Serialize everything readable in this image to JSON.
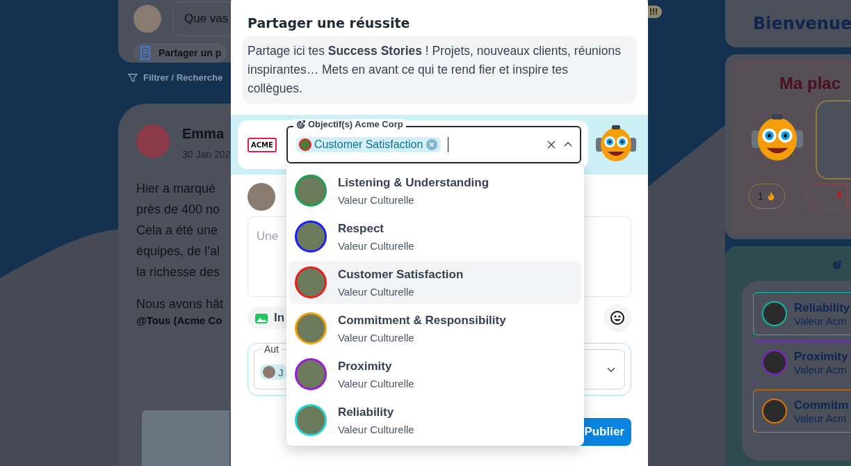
{
  "feed": {
    "composer_placeholder": "Que vas",
    "share_post_button": "Partager un p",
    "filter_link": "Filtrer / Recherche",
    "badge": "!!!",
    "post": {
      "author": "Emma",
      "date": "30 Jan 202",
      "lines": [
        "Hier a marqué",
        "près de 400 no",
        "Cela a été une",
        "équipes, de l’al",
        "la richesse des"
      ],
      "line_after": "Nous avons hât",
      "mention": "@Tous (Acme Co"
    }
  },
  "sidebar": {
    "welcome": "Bienvenue",
    "place_title": "Ma plac",
    "streak": "1",
    "values": [
      {
        "name": "Reliability",
        "subtitle": "Valeur Acm",
        "color": "#14b8a6"
      },
      {
        "name": "Proximity",
        "subtitle": "Valeur Acm",
        "color": "#7e22ce"
      },
      {
        "name": "Commitm",
        "subtitle": "Valeur Acm",
        "color": "#d97706"
      }
    ]
  },
  "modal": {
    "title": "Partager une réussite",
    "intro": "Partage ici tes **Success Stories** ! Projets, nouveaux clients, réunions inspirantes… Mets en avant ce qui te rend fier et inspire tes collègues.",
    "logo_text": "ACME",
    "objectives_label": "Objectif(s) Acme Corp",
    "chips": [
      {
        "label": "Customer Satisfaction",
        "color": "#ef1c1c"
      }
    ],
    "text_placeholder": "Une",
    "image_button": "In",
    "author_label": "Aut",
    "author_chip": "J",
    "publish_button": "Publier",
    "options": [
      {
        "title": "Listening & Understanding",
        "subtitle": "Valeur Culturelle",
        "color": "#16a34a",
        "highlighted": false
      },
      {
        "title": "Respect",
        "subtitle": "Valeur Culturelle",
        "color": "#1d1dfa",
        "highlighted": false
      },
      {
        "title": "Customer Satisfaction",
        "subtitle": "Valeur Culturelle",
        "color": "#ef1c1c",
        "highlighted": true
      },
      {
        "title": "Commitment & Responsibility",
        "subtitle": "Valeur Culturelle",
        "color": "#f59e0b",
        "highlighted": false
      },
      {
        "title": "Proximity",
        "subtitle": "Valeur Culturelle",
        "color": "#9b19d8",
        "highlighted": false
      },
      {
        "title": "Reliability",
        "subtitle": "Valeur Culturelle",
        "color": "#22d3d3",
        "highlighted": false
      }
    ]
  }
}
